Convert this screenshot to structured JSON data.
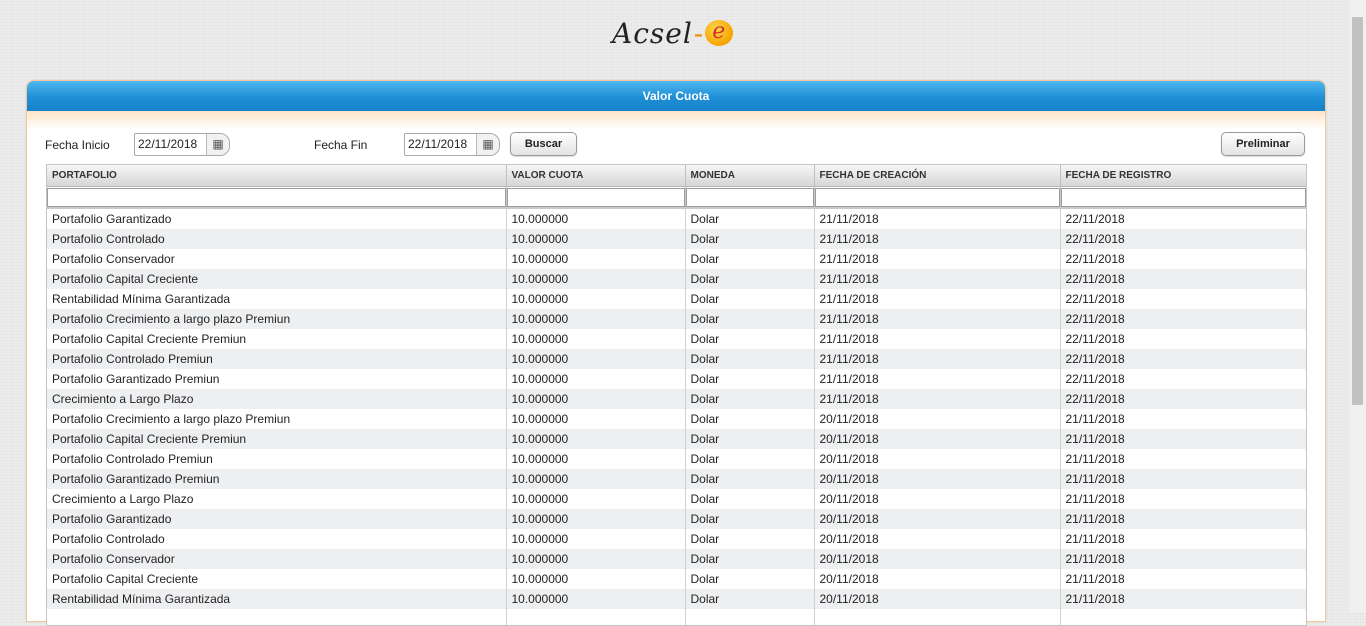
{
  "logo": {
    "text": "Acsel",
    "dash": "-",
    "e": "e"
  },
  "panel": {
    "title": "Valor Cuota"
  },
  "filters": {
    "start_label": "Fecha Inicio",
    "start_value": "22/11/2018",
    "end_label": "Fecha Fin",
    "end_value": "22/11/2018",
    "search_label": "Buscar",
    "preliminar_label": "Preliminar"
  },
  "table": {
    "columns": [
      "PORTAFOLIO",
      "VALOR CUOTA",
      "MONEDA",
      "FECHA DE CREACIÓN",
      "FECHA DE REGISTRO"
    ],
    "rows": [
      [
        "Portafolio Garantizado",
        "10.000000",
        "Dolar",
        "21/11/2018",
        "22/11/2018"
      ],
      [
        "Portafolio Controlado",
        "10.000000",
        "Dolar",
        "21/11/2018",
        "22/11/2018"
      ],
      [
        "Portafolio Conservador",
        "10.000000",
        "Dolar",
        "21/11/2018",
        "22/11/2018"
      ],
      [
        "Portafolio Capital Creciente",
        "10.000000",
        "Dolar",
        "21/11/2018",
        "22/11/2018"
      ],
      [
        "Rentabilidad Mínima Garantizada",
        "10.000000",
        "Dolar",
        "21/11/2018",
        "22/11/2018"
      ],
      [
        "Portafolio Crecimiento a largo plazo Premiun",
        "10.000000",
        "Dolar",
        "21/11/2018",
        "22/11/2018"
      ],
      [
        "Portafolio Capital Creciente Premiun",
        "10.000000",
        "Dolar",
        "21/11/2018",
        "22/11/2018"
      ],
      [
        "Portafolio Controlado Premiun",
        "10.000000",
        "Dolar",
        "21/11/2018",
        "22/11/2018"
      ],
      [
        "Portafolio Garantizado Premiun",
        "10.000000",
        "Dolar",
        "21/11/2018",
        "22/11/2018"
      ],
      [
        "Crecimiento a Largo Plazo",
        "10.000000",
        "Dolar",
        "21/11/2018",
        "22/11/2018"
      ],
      [
        "Portafolio Crecimiento a largo plazo Premiun",
        "10.000000",
        "Dolar",
        "20/11/2018",
        "21/11/2018"
      ],
      [
        "Portafolio Capital Creciente Premiun",
        "10.000000",
        "Dolar",
        "20/11/2018",
        "21/11/2018"
      ],
      [
        "Portafolio Controlado Premiun",
        "10.000000",
        "Dolar",
        "20/11/2018",
        "21/11/2018"
      ],
      [
        "Portafolio Garantizado Premiun",
        "10.000000",
        "Dolar",
        "20/11/2018",
        "21/11/2018"
      ],
      [
        "Crecimiento a Largo Plazo",
        "10.000000",
        "Dolar",
        "20/11/2018",
        "21/11/2018"
      ],
      [
        "Portafolio Garantizado",
        "10.000000",
        "Dolar",
        "20/11/2018",
        "21/11/2018"
      ],
      [
        "Portafolio Controlado",
        "10.000000",
        "Dolar",
        "20/11/2018",
        "21/11/2018"
      ],
      [
        "Portafolio Conservador",
        "10.000000",
        "Dolar",
        "20/11/2018",
        "21/11/2018"
      ],
      [
        "Portafolio Capital Creciente",
        "10.000000",
        "Dolar",
        "20/11/2018",
        "21/11/2018"
      ],
      [
        "Rentabilidad Mínima Garantizada",
        "10.000000",
        "Dolar",
        "20/11/2018",
        "21/11/2018"
      ],
      [
        "",
        "",
        "",
        "",
        ""
      ]
    ]
  },
  "icons": {
    "calendar": "calendar-icon"
  }
}
